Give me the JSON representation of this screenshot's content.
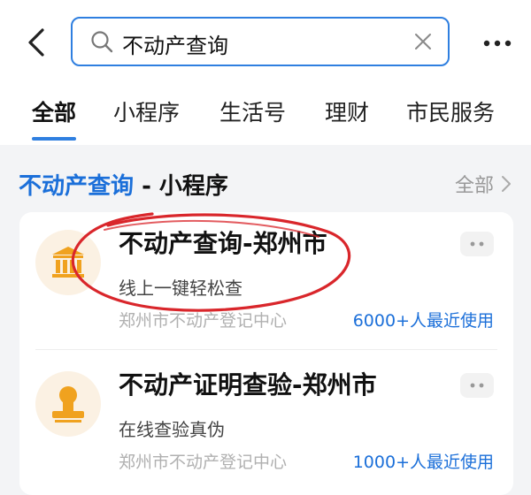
{
  "search": {
    "query": "不动产查询"
  },
  "tabs": [
    {
      "label": "全部"
    },
    {
      "label": "小程序"
    },
    {
      "label": "生活号"
    },
    {
      "label": "理财"
    },
    {
      "label": "市民服务"
    }
  ],
  "section": {
    "title_keyword": "不动产查询",
    "title_suffix": " - 小程序",
    "all_link": "全部"
  },
  "results": [
    {
      "name": "不动产查询-郑州市",
      "desc": "线上一键轻松查",
      "org": "郑州市不动产登记中心",
      "usage": "6000+人最近使用",
      "icon": "bank-building-icon"
    },
    {
      "name": "不动产证明查验-郑州市",
      "desc": "在线查验真伪",
      "org": "郑州市不动产登记中心",
      "usage": "1000+人最近使用",
      "icon": "stamp-icon"
    }
  ],
  "colors": {
    "accent": "#2f7fe0",
    "link": "#1b6fd9",
    "icon_gold": "#f0a21f",
    "annotation_red": "#d9262b"
  }
}
